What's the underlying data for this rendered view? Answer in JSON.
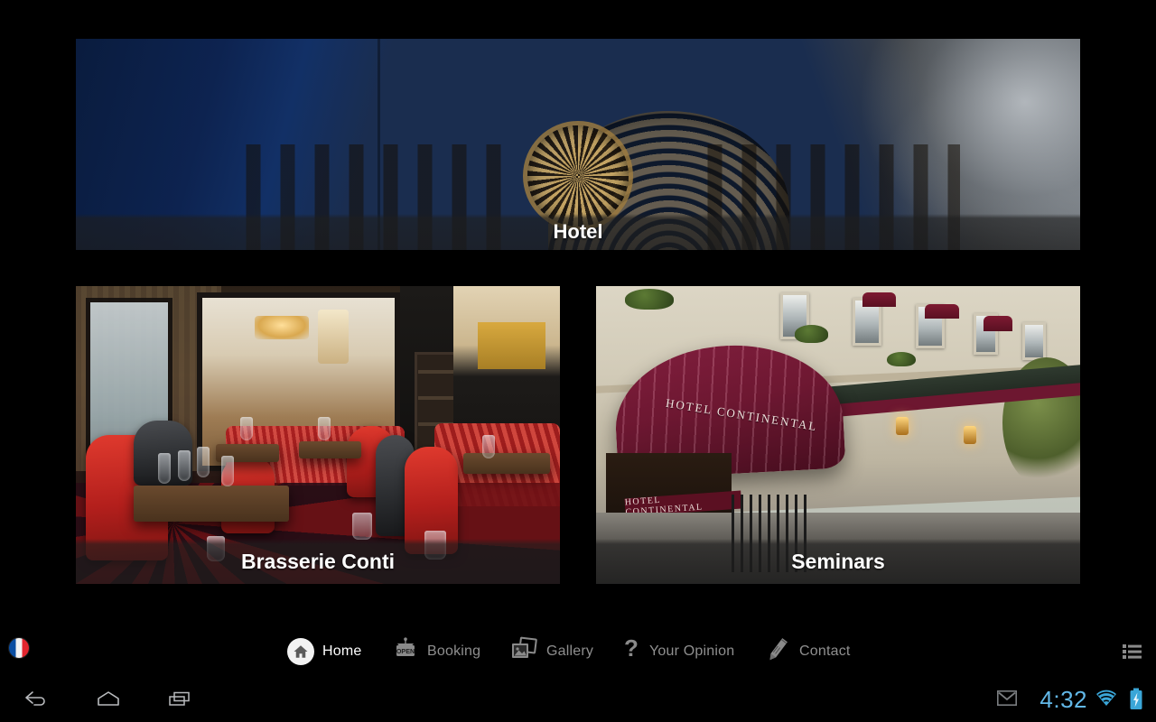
{
  "app": {
    "background_color": "#000000",
    "tiles": [
      {
        "id": "hotel",
        "label": "Hotel",
        "image_description": "Gothic cathedral facade at dusk"
      },
      {
        "id": "brasserie",
        "label": "Brasserie Conti",
        "image_description": "Restaurant interior with red chairs and set tables"
      },
      {
        "id": "seminars",
        "label": "Seminars",
        "image_description": "Hotel Continental street facade with burgundy awning"
      }
    ]
  },
  "photo_text": {
    "canopy": "HOTEL CONTINENTAL",
    "door_sign": "HOTEL CONTINENTAL"
  },
  "nav": {
    "language_flag": "france-flag-icon",
    "items": [
      {
        "id": "home",
        "label": "Home",
        "icon": "home-icon",
        "active": true
      },
      {
        "id": "booking",
        "label": "Booking",
        "icon": "open-sign-icon",
        "active": false
      },
      {
        "id": "gallery",
        "label": "Gallery",
        "icon": "photos-icon",
        "active": false
      },
      {
        "id": "youropinion",
        "label": "Your Opinion",
        "icon": "question-mark-icon",
        "active": false
      },
      {
        "id": "contact",
        "label": "Contact",
        "icon": "pencil-icon",
        "active": false
      }
    ],
    "menu_icon": "list-menu-icon",
    "active_color": "#ffffff",
    "inactive_color": "#8f8f8f"
  },
  "system_bar": {
    "back_icon": "back-arrow-icon",
    "home_icon": "android-home-icon",
    "recents_icon": "recent-apps-icon",
    "notification_icon": "gmail-icon",
    "clock": "4:32",
    "wifi_icon": "wifi-icon",
    "battery_icon": "battery-charging-icon",
    "clock_color": "#62b8e8"
  }
}
